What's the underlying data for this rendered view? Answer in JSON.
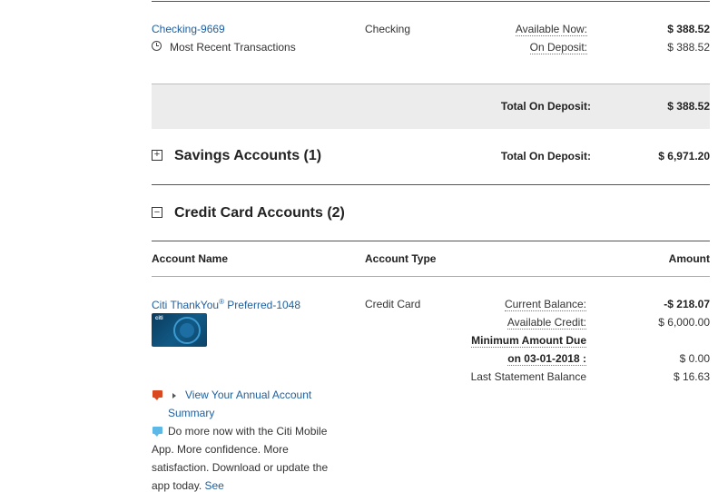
{
  "checking": {
    "account_link": "Checking-9669",
    "recent_label": "Most Recent Transactions",
    "type": "Checking",
    "available_label": "Available Now:",
    "available_value": "$ 388.52",
    "deposit_label": "On Deposit:",
    "deposit_value": "$ 388.52",
    "total_label": "Total On Deposit:",
    "total_value": "$ 388.52"
  },
  "savings": {
    "toggle": "+",
    "title": "Savings Accounts (1)",
    "total_label": "Total On Deposit:",
    "total_value": "$ 6,971.20"
  },
  "credit": {
    "toggle": "−",
    "title": "Credit Card Accounts (2)",
    "headers": {
      "name": "Account Name",
      "type": "Account Type",
      "amount": "Amount"
    },
    "account": {
      "name": "Citi ThankYou",
      "reg": "®",
      "name_suffix": " Preferred-1048",
      "type": "Credit Card",
      "card_logo": "citi",
      "current_balance_label": "Current Balance:",
      "current_balance_value": "-$ 218.07",
      "available_credit_label": "Available Credit:",
      "available_credit_value": "$ 6,000.00",
      "min_due_label_1": "Minimum Amount Due",
      "min_due_label_2": "on 03-01-2018 :",
      "min_due_value": "$ 0.00",
      "last_statement_label": "Last Statement Balance",
      "last_statement_value": "$ 16.63"
    },
    "promo": {
      "annual_link_1": "View Your Annual Account",
      "annual_link_2": "Summary",
      "mobile_line_1": "Do more now with the Citi Mobile",
      "mobile_line_2": "App. More confidence. More",
      "mobile_line_3": "satisfaction. Download or update the",
      "mobile_line_4": "app today.",
      "mobile_link": "See"
    }
  },
  "icons": {
    "clock": "clock-icon",
    "plus": "expand-icon",
    "minus": "collapse-icon",
    "triangle": "triangle-right-icon",
    "chat_red": "chat-bubble-red-icon",
    "chat_blue": "chat-bubble-blue-icon"
  },
  "colors": {
    "link": "#1f5f9e",
    "band": "#ececec",
    "chat_red": "#d9481f",
    "chat_blue": "#5cb8e6"
  }
}
